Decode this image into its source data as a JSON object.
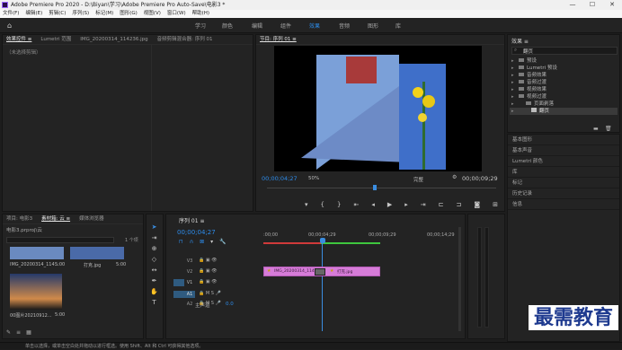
{
  "titlebar": {
    "title": "Adobe Premiere Pro 2020 - D:\\Biyan\\学习\\Adobe Premiere Pro Auto-Save\\电影3 *",
    "min": "—",
    "max": "☐",
    "close": "✕"
  },
  "menu": [
    "文件(F)",
    "编辑(E)",
    "剪辑(C)",
    "序列(S)",
    "标记(M)",
    "图形(G)",
    "视图(V)",
    "窗口(W)",
    "帮助(H)"
  ],
  "workspaces": [
    "学习",
    "组件",
    "编辑",
    "颜色",
    "效果",
    "音频",
    "图形",
    "库"
  ],
  "workspace_active": "效果",
  "source_panel": {
    "tabs": [
      "效果控件 ≡",
      "Lumetri 范围",
      "IMG_20200314_114236.jpg",
      "音频剪辑混合器: 序列 01"
    ],
    "no_clip": "（未选择剪辑）"
  },
  "program": {
    "title": "节目: 序列 01 ≡",
    "timecode": "00;00;04;27",
    "zoom": "50%",
    "quality": "完整",
    "duration": "00;00;09;29"
  },
  "effects": {
    "title": "效果 ≡",
    "search": "翻页",
    "items": [
      "预设",
      "Lumetri 预设",
      "音频效果",
      "音频过渡",
      "视频效果",
      "视频过渡"
    ],
    "sub_folder": "页面剥落",
    "sub_item": "翻页"
  },
  "side_panels": [
    "基本图形",
    "基本声音",
    "Lumetri 颜色",
    "库",
    "标记",
    "历史记录",
    "信息"
  ],
  "project": {
    "tabs": [
      "项目: 电影3",
      "素材箱: 云 ≡",
      "媒体浏览器"
    ],
    "path": "电影3.prproj\\云",
    "count": "1 个项",
    "clips": [
      {
        "name": "IMG_20200314_114...",
        "dur": "5:00"
      },
      {
        "name": "打克.jpg",
        "dur": "5:00"
      },
      {
        "name": "00图片20210912...",
        "dur": "5:00"
      }
    ]
  },
  "timeline": {
    "title": "序列 01 ≡",
    "timecode": "00;00;04;27",
    "ruler": [
      ":00;00",
      "00;00;04;29",
      "00;00;09;29",
      "00;00;14;29"
    ],
    "tracks_v": [
      "V3",
      "V2",
      "V1"
    ],
    "tracks_a": [
      "A1",
      "A2"
    ],
    "master": "主声道",
    "master_val": "0.0",
    "clip1": "IMG_20200314_114236.",
    "clip2": "打克.jpg"
  },
  "status": "单击以选择，或单击空白处并拖动以进行框选。使用 Shift、Alt 和 Ctrl 可获得其他选项。",
  "watermark": "最需教育",
  "colors": {
    "accent": "#2d8ceb",
    "clip": "#d67cd8",
    "playhead": "#3a8de0"
  }
}
